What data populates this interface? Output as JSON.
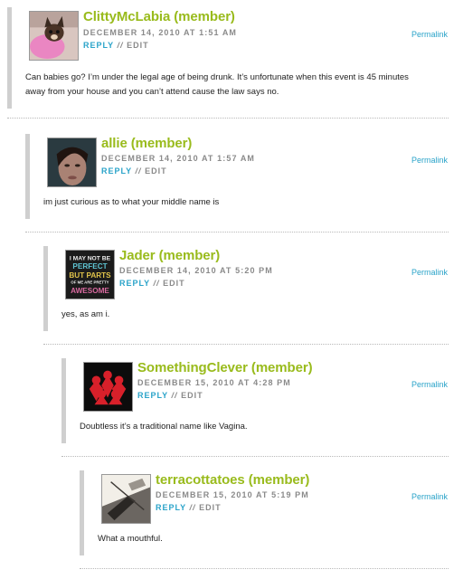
{
  "comments": [
    {
      "author": "ClittyMcLabia (member)",
      "date": "DECEMBER 14, 2010 AT 1:51 AM",
      "reply_label": "REPLY",
      "separator": "//",
      "edit_label": "EDIT",
      "permalink_label": "Permalink",
      "text": "Can babies go? I’m under the legal age of being drunk. It’s unfortunate when this event is 45 minutes away from your house and you can’t attend cause the law says no."
    },
    {
      "author": "allie (member)",
      "date": "DECEMBER 14, 2010 AT 1:57 AM",
      "reply_label": "REPLY",
      "separator": "//",
      "edit_label": "EDIT",
      "permalink_label": "Permalink",
      "text": "im just curious as to what your middle name is"
    },
    {
      "author": "Jader (member)",
      "date": "DECEMBER 14, 2010 AT 5:20 PM",
      "reply_label": "REPLY",
      "separator": "//",
      "edit_label": "EDIT",
      "permalink_label": "Permalink",
      "text": "yes, as am i.",
      "avatar_text": [
        "I MAY NOT BE",
        "PERFECT",
        "BUT PARTS",
        "OF ME ARE PRETTY",
        "AWESOME"
      ]
    },
    {
      "author": "SomethingClever (member)",
      "date": "DECEMBER 15, 2010 AT 4:28 PM",
      "reply_label": "REPLY",
      "separator": "//",
      "edit_label": "EDIT",
      "permalink_label": "Permalink",
      "text": "Doubtless it’s a traditional name like Vagina."
    },
    {
      "author": "terracottatoes (member)",
      "date": "DECEMBER 15, 2010 AT 5:19 PM",
      "reply_label": "REPLY",
      "separator": "//",
      "edit_label": "EDIT",
      "permalink_label": "Permalink",
      "text": "What a mouthful."
    }
  ],
  "colors": {
    "author": "#99bb1c",
    "link": "#2aa3c9",
    "meta": "#8a8a8a",
    "bar": "#cfcfcf"
  },
  "icons": [
    "avatar-image",
    "avatar-image",
    "avatar-image",
    "avatar-image",
    "avatar-image"
  ]
}
